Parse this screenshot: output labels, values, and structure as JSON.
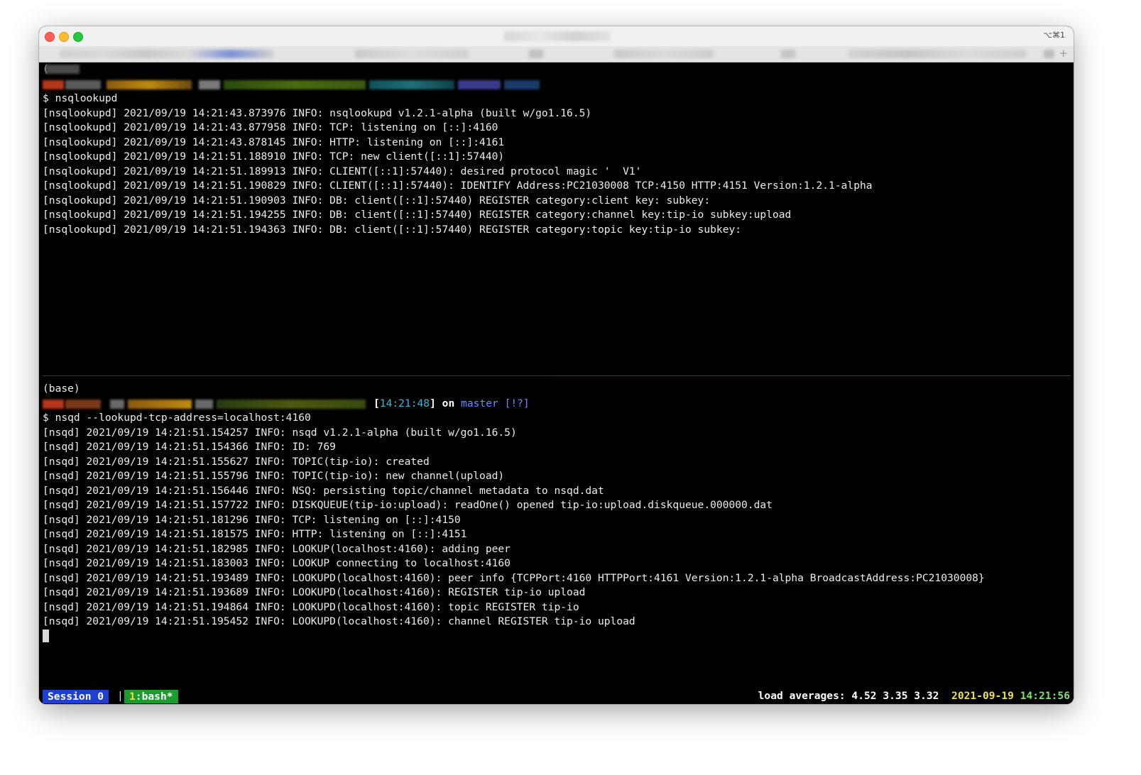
{
  "window": {
    "shortcut": "⌥⌘1"
  },
  "top_pane": {
    "base_label": "(",
    "command": "$ nsqlookupd",
    "logs": [
      "[nsqlookupd] 2021/09/19 14:21:43.873976 INFO: nsqlookupd v1.2.1-alpha (built w/go1.16.5)",
      "[nsqlookupd] 2021/09/19 14:21:43.877958 INFO: TCP: listening on [::]:4160",
      "[nsqlookupd] 2021/09/19 14:21:43.878145 INFO: HTTP: listening on [::]:4161",
      "[nsqlookupd] 2021/09/19 14:21:51.188910 INFO: TCP: new client([::1]:57440)",
      "[nsqlookupd] 2021/09/19 14:21:51.189913 INFO: CLIENT([::1]:57440): desired protocol magic '  V1'",
      "[nsqlookupd] 2021/09/19 14:21:51.190829 INFO: CLIENT([::1]:57440): IDENTIFY Address:PC21030008 TCP:4150 HTTP:4151 Version:1.2.1-alpha",
      "[nsqlookupd] 2021/09/19 14:21:51.190903 INFO: DB: client([::1]:57440) REGISTER category:client key: subkey:",
      "[nsqlookupd] 2021/09/19 14:21:51.194255 INFO: DB: client([::1]:57440) REGISTER category:channel key:tip-io subkey:upload",
      "[nsqlookupd] 2021/09/19 14:21:51.194363 INFO: DB: client([::1]:57440) REGISTER category:topic key:tip-io subkey:"
    ]
  },
  "bottom_pane": {
    "base_label": "(base)",
    "prompt_time": "14:21:48",
    "prompt_on": "on",
    "prompt_branch": "master",
    "prompt_status": "[!?]",
    "command": "$ nsqd --lookupd-tcp-address=localhost:4160",
    "logs": [
      "[nsqd] 2021/09/19 14:21:51.154257 INFO: nsqd v1.2.1-alpha (built w/go1.16.5)",
      "[nsqd] 2021/09/19 14:21:51.154366 INFO: ID: 769",
      "[nsqd] 2021/09/19 14:21:51.155627 INFO: TOPIC(tip-io): created",
      "[nsqd] 2021/09/19 14:21:51.155796 INFO: TOPIC(tip-io): new channel(upload)",
      "[nsqd] 2021/09/19 14:21:51.156446 INFO: NSQ: persisting topic/channel metadata to nsqd.dat",
      "[nsqd] 2021/09/19 14:21:51.157722 INFO: DISKQUEUE(tip-io:upload): readOne() opened tip-io:upload.diskqueue.000000.dat",
      "[nsqd] 2021/09/19 14:21:51.181296 INFO: TCP: listening on [::]:4150",
      "[nsqd] 2021/09/19 14:21:51.181575 INFO: HTTP: listening on [::]:4151",
      "[nsqd] 2021/09/19 14:21:51.182985 INFO: LOOKUP(localhost:4160): adding peer",
      "[nsqd] 2021/09/19 14:21:51.183003 INFO: LOOKUP connecting to localhost:4160",
      "[nsqd] 2021/09/19 14:21:51.193489 INFO: LOOKUPD(localhost:4160): peer info {TCPPort:4160 HTTPPort:4161 Version:1.2.1-alpha BroadcastAddress:PC21030008}",
      "[nsqd] 2021/09/19 14:21:51.193689 INFO: LOOKUPD(localhost:4160): REGISTER tip-io upload",
      "[nsqd] 2021/09/19 14:21:51.194864 INFO: LOOKUPD(localhost:4160): topic REGISTER tip-io",
      "[nsqd] 2021/09/19 14:21:51.195452 INFO: LOOKUPD(localhost:4160): channel REGISTER tip-io upload"
    ]
  },
  "status_bar": {
    "session": "Session 0",
    "separator": "|",
    "window_num": "1",
    "window_name": ":bash*",
    "load_averages": "load averages: 4.52 3.35 3.32",
    "date": "2021-09-19",
    "time": "14:21:56"
  },
  "colors": {
    "session_bg": "#1f3fd0",
    "window_tab_bg": "#1c9c2c",
    "prompt_time": "#3fb9d3",
    "branch": "#6c8cff",
    "date": "#f0e04a",
    "clock": "#7ee36b"
  }
}
